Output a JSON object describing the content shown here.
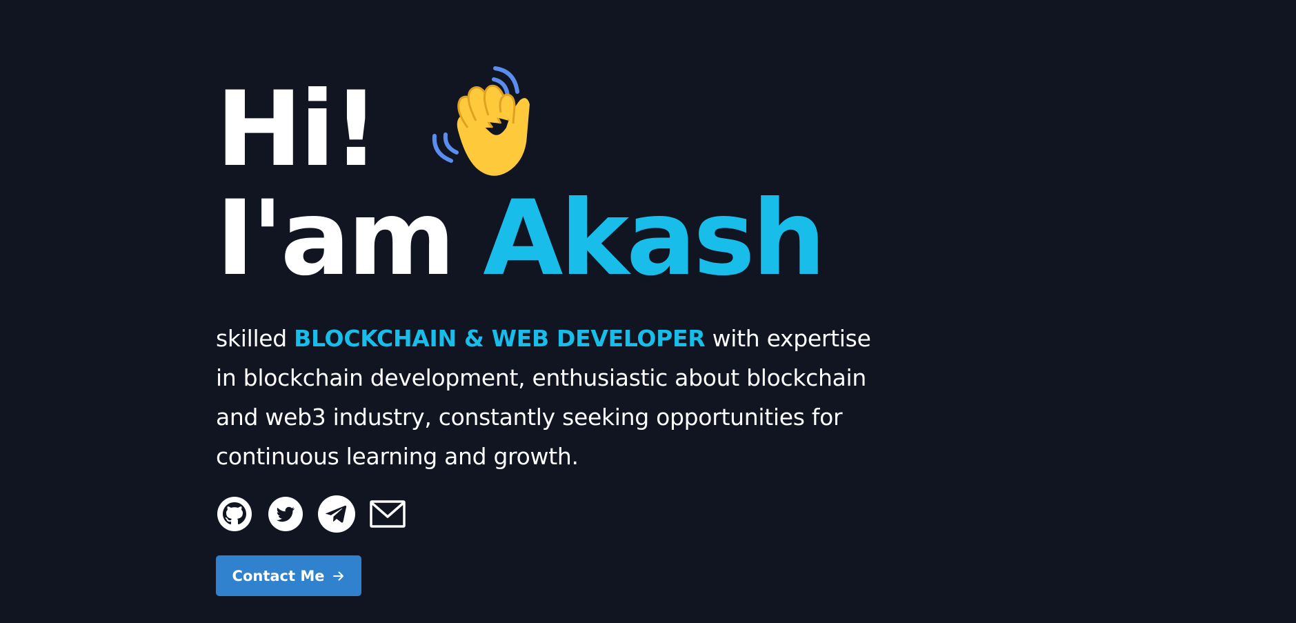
{
  "hero": {
    "greeting": "Hi!",
    "wave_icon": "waving-hand-icon",
    "iam": "I'am",
    "name": "Akash"
  },
  "bio": {
    "prefix": "skilled ",
    "highlight": "BLOCKCHAIN & WEB DEVELOPER",
    "suffix": " with expertise in blockchain development, enthusiastic about blockchain and web3 industry, constantly seeking opportunities for continuous learning and growth."
  },
  "socials": [
    {
      "icon": "github-icon"
    },
    {
      "icon": "twitter-icon"
    },
    {
      "icon": "telegram-icon"
    },
    {
      "icon": "mail-icon"
    }
  ],
  "cta": {
    "label": "Contact Me",
    "icon": "arrow-right-icon"
  },
  "colors": {
    "background": "#111522",
    "accent": "#18bde9",
    "button": "#3182ce",
    "text": "#ffffff"
  }
}
